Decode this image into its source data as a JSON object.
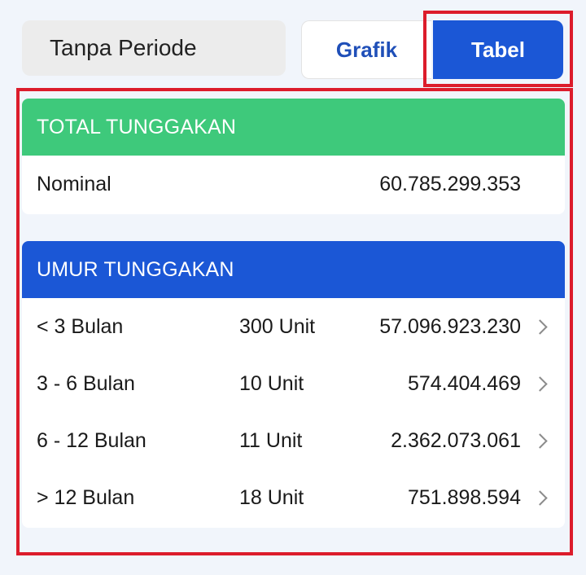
{
  "period": {
    "label": "Tanpa Periode"
  },
  "tabs": [
    {
      "label": "Grafik",
      "selected": false
    },
    {
      "label": "Tabel",
      "selected": true
    }
  ],
  "colors": {
    "accent_blue": "#1b57d6",
    "header_green": "#3ec97b",
    "highlight_red": "#dc1c2b"
  },
  "total": {
    "title": "TOTAL TUNGGAKAN",
    "rows": [
      {
        "label": "Nominal",
        "value": "60.785.299.353"
      }
    ]
  },
  "umur": {
    "title": "UMUR TUNGGAKAN",
    "rows": [
      {
        "label": "< 3 Bulan",
        "unit": "300 Unit",
        "value": "57.096.923.230"
      },
      {
        "label": "3 - 6 Bulan",
        "unit": "10 Unit",
        "value": "574.404.469"
      },
      {
        "label": "6 - 12 Bulan",
        "unit": "11 Unit",
        "value": "2.362.073.061"
      },
      {
        "label": "> 12 Bulan",
        "unit": "18 Unit",
        "value": "751.898.594"
      }
    ]
  }
}
